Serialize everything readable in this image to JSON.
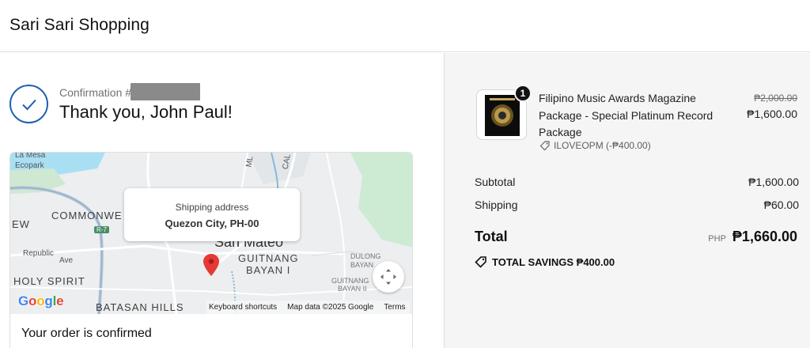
{
  "header": {
    "store_name": "Sari Sari Shopping"
  },
  "confirmation": {
    "label": "Confirmation #",
    "thanks": "Thank you, John Paul!"
  },
  "map": {
    "labels": {
      "la_mesa": "La Mesa",
      "ecopark": "Ecopark",
      "commonwealth": "COMMONWE",
      "ew": "EW",
      "r7": "R-7",
      "republic": "Republic",
      "ave": "Ave",
      "holy_spirit": "HOLY SPIRIT",
      "batasan_hills": "BATASAN HILLS",
      "san_mateo": "San Mateo",
      "guitnang_bayan_1_a": "GUITNANG",
      "guitnang_bayan_1_b": "BAYAN I",
      "dulong_a": "DULONG",
      "dulong_b": "BAYAN",
      "guitnang2_a": "GUITNANG",
      "guitnang2_b": "BAYAN II",
      "road_ml": "ML",
      "road_cal": "CAL"
    },
    "popup": {
      "title": "Shipping address",
      "value": "Quezon City, PH-00"
    },
    "footer": {
      "shortcuts": "Keyboard shortcuts",
      "map_data": "Map data ©2025 Google",
      "terms": "Terms"
    },
    "google": {
      "g1": "G",
      "o1": "o",
      "o2": "o",
      "g2": "g",
      "l": "l",
      "e": "e"
    }
  },
  "status": {
    "order_confirmed": "Your order is confirmed"
  },
  "cart": {
    "item": {
      "quantity": "1",
      "title": "Filipino Music Awards Magazine Package - Special Platinum Record Package",
      "discount_code": "ILOVEOPM (-₱400.00)",
      "original_price": "₱2,000.00",
      "price": "₱1,600.00"
    },
    "subtotal_label": "Subtotal",
    "subtotal_value": "₱1,600.00",
    "shipping_label": "Shipping",
    "shipping_value": "₱60.00",
    "total_label": "Total",
    "currency": "PHP",
    "total_value": "₱1,660.00",
    "savings_text": "TOTAL SAVINGS ₱400.00"
  },
  "colors": {
    "accent": "#1f5fb0",
    "pin": "#e53935",
    "sidebar_bg": "#f5f5f5"
  },
  "icons": [
    "check-icon",
    "map-pin-icon",
    "fullscreen-icon",
    "tag-icon"
  ]
}
